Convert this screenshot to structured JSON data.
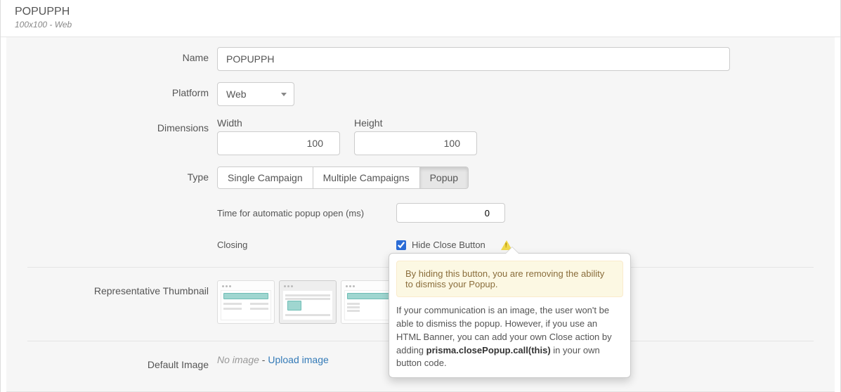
{
  "header": {
    "title": "POPUPPH",
    "subtitle": "100x100 - Web"
  },
  "form": {
    "name": {
      "label": "Name",
      "value": "POPUPPH"
    },
    "platform": {
      "label": "Platform",
      "value": "Web"
    },
    "dimensions": {
      "label": "Dimensions",
      "width_label": "Width",
      "width_value": "100",
      "height_label": "Height",
      "height_value": "100"
    },
    "type": {
      "label": "Type",
      "options": [
        "Single Campaign",
        "Multiple Campaigns",
        "Popup"
      ],
      "selected_index": 2
    },
    "popup_time": {
      "label": "Time for automatic popup open (ms)",
      "value": "0"
    },
    "closing": {
      "label": "Closing",
      "checkbox_label": "Hide Close Button",
      "checked": true
    }
  },
  "thumbnail": {
    "label": "Representative Thumbnail"
  },
  "default_image": {
    "label": "Default Image",
    "no_image": "No image",
    "separator": " - ",
    "upload": "Upload image"
  },
  "popover": {
    "alert_text": "By hiding this button, you are removing the ability to dismiss your Popup.",
    "body_pre": "If your communication is an image, the user won't be able to dismiss the popup. However, if you use an HTML Banner, you can add your own Close action by adding ",
    "body_code": "prisma.closePopup.call(this)",
    "body_post": " in your own button code."
  }
}
